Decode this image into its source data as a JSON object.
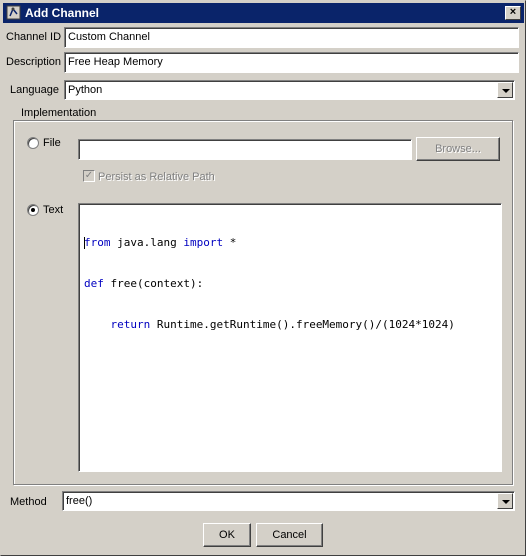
{
  "window": {
    "title": "Add Channel",
    "close_glyph": "×"
  },
  "channel_id": {
    "label": "Channel ID",
    "value": "Custom Channel"
  },
  "description": {
    "label": "Description",
    "value": "Free Heap Memory"
  },
  "language": {
    "label": "Language",
    "selected": "Python"
  },
  "implementation": {
    "title": "Implementation",
    "file": {
      "label": "File",
      "value": "",
      "browse_label": "Browse...",
      "persist_label": "Persist as Relative Path",
      "persist_checked": true
    },
    "text": {
      "label": "Text",
      "code_lines": [
        {
          "kw": "from",
          "rest": " java.lang ",
          "kw2": "import",
          "tail": " *"
        },
        {
          "kw": "def",
          "rest": " free(context):"
        },
        {
          "indent": "    ",
          "kw": "return",
          "rest": " Runtime.getRuntime().freeMemory()/(1024*1024)"
        }
      ]
    }
  },
  "method": {
    "label": "Method",
    "selected": "free()"
  },
  "buttons": {
    "ok": "OK",
    "cancel": "Cancel"
  },
  "colors": {
    "titlebar": "#0a246a",
    "keyword": "#0000c0",
    "dialog_bg": "#d4d0c8"
  }
}
